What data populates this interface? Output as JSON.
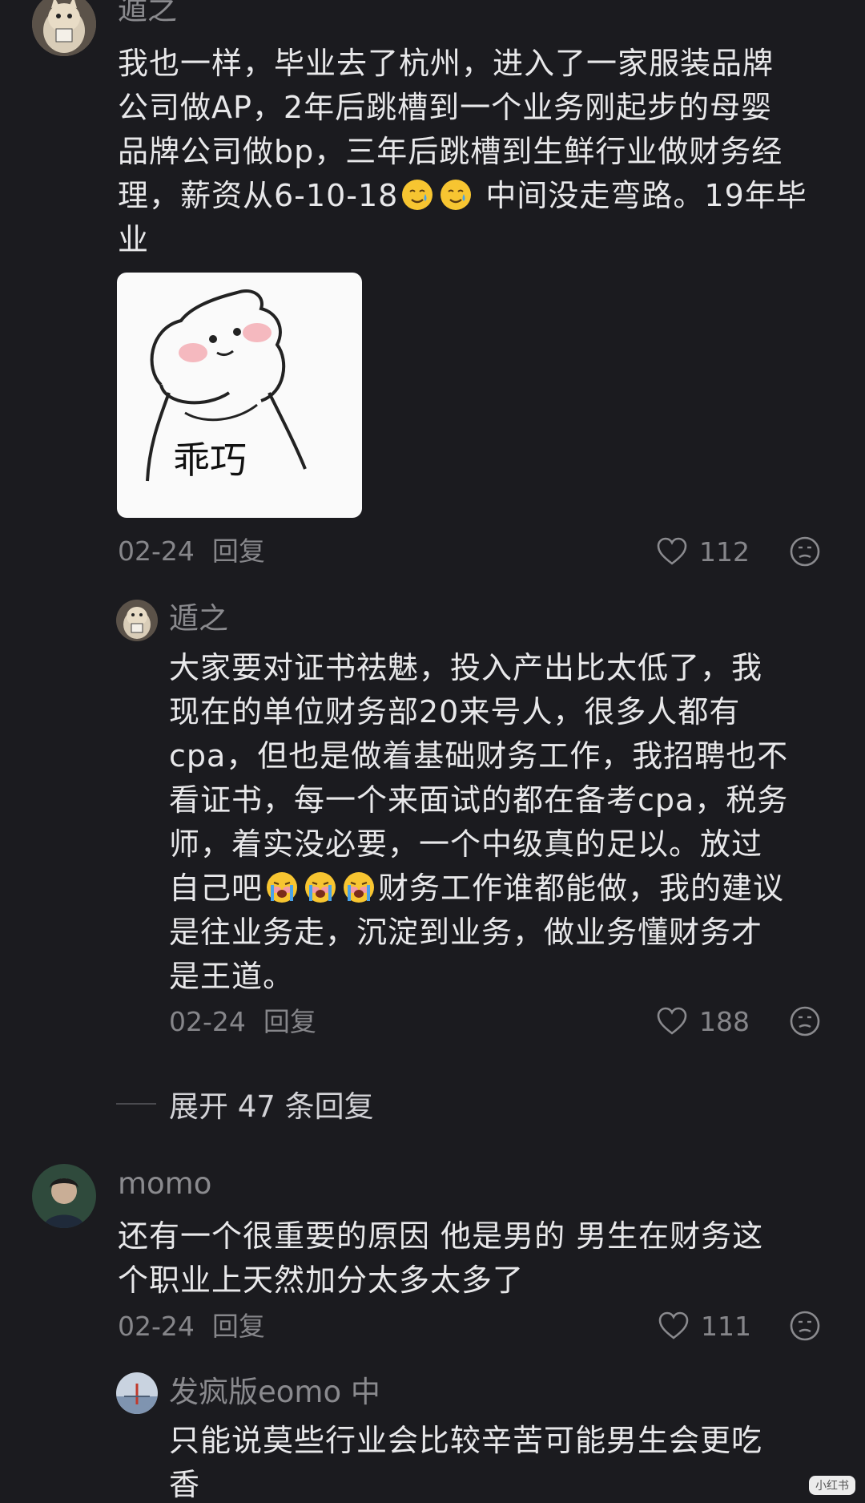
{
  "comments": [
    {
      "author": "遁之",
      "text_lines": [
        "我也一样，毕业去了杭州，进入了一家服装品牌",
        "公司做AP，2年后跳槽到一个业务刚起步的母婴",
        "品牌公司做bp，三年后跳槽到生鲜行业做财务经",
        "理，薪资从6-10-18",
        " 中间没走弯路。19年毕",
        "业"
      ],
      "sticker_text": "乖巧",
      "date": "02-24",
      "reply_label": "回复",
      "likes": "112"
    },
    {
      "author": "momo",
      "text_lines": [
        "还有一个很重要的原因 他是男的 男生在财务这",
        "个职业上天然加分太多太多了"
      ],
      "date": "02-24",
      "reply_label": "回复",
      "likes": "111"
    }
  ],
  "replies": [
    {
      "author": "遁之",
      "text_lines": [
        "大家要对证书祛魅，投入产出比太低了，我",
        "现在的单位财务部20来号人，很多人都有",
        "cpa，但也是做着基础财务工作，我招聘也不",
        "看证书，每一个来面试的都在备考cpa，税务",
        "师，着实没必要，一个中级真的足以。放过",
        "自己吧",
        "财务工作谁都能做，我的建议",
        "是往业务走，沉淀到业务，做业务懂财务才",
        "是王道。"
      ],
      "date": "02-24",
      "reply_label": "回复",
      "likes": "188"
    },
    {
      "author": "发疯版eomo 中",
      "text_lines": [
        "只能说莫些行业会比较辛苦可能男生会更吃",
        "香"
      ]
    }
  ],
  "expand_label": "展开 47 条回复",
  "watermark": "小红书",
  "colors": {
    "background": "#1b1b1f",
    "text": "#e8e8ea",
    "muted": "#86868a"
  },
  "icons": [
    "heart-icon",
    "dislike-face-icon",
    "tearful-smile-emoji",
    "crying-emoji"
  ]
}
